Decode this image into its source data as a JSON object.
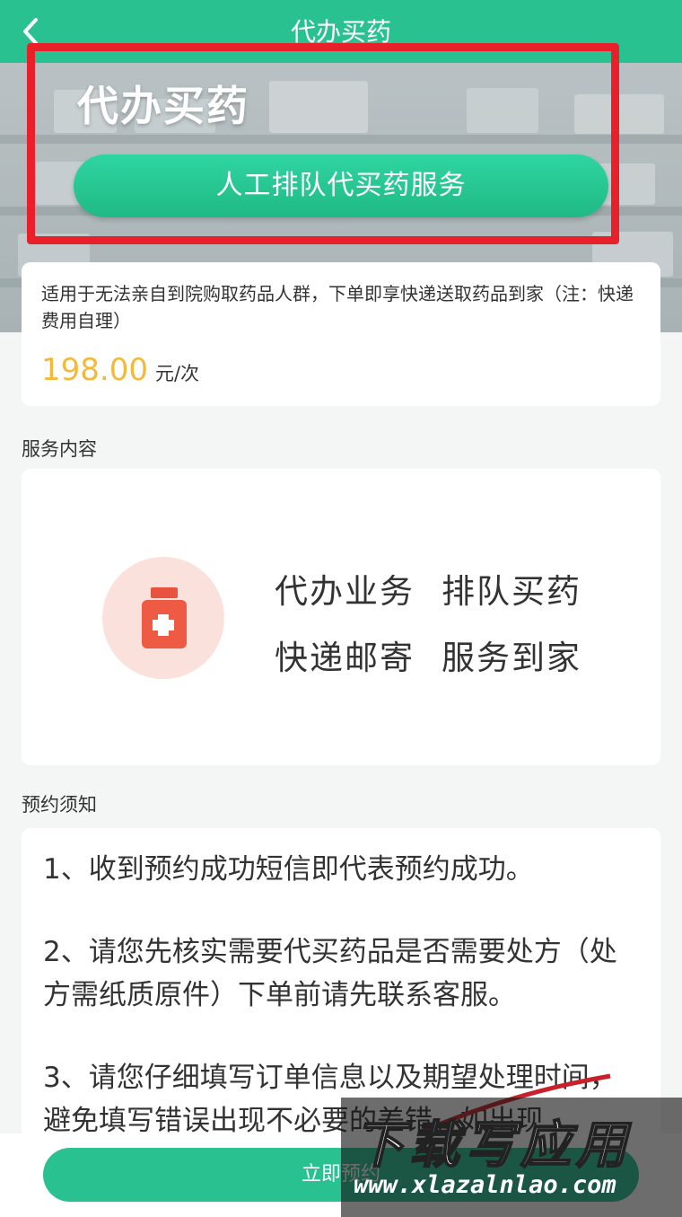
{
  "header": {
    "title": "代办买药"
  },
  "banner": {
    "title": "代办买药",
    "button_label": "人工排队代买药服务"
  },
  "price_card": {
    "description": "适用于无法亲自到院购取药品人群，下单即享快递送取药品到家（注：快递费用自理）",
    "price": "198.00",
    "unit": "元/次"
  },
  "service": {
    "section_title": "服务内容",
    "items": [
      "代办业务",
      "排队买药",
      "快递邮寄",
      "服务到家"
    ]
  },
  "notice": {
    "section_title": "预约须知",
    "items": [
      "1、收到预约成功短信即代表预约成功。",
      "2、请您先核实需要代买药品是否需要处方（处方需纸质原件）下单前请先联系客服。",
      "3、请您仔细填写订单信息以及期望处理时间，避免填写错误出现不必要的差错，如出现"
    ]
  },
  "footer": {
    "button_label": "立即预约"
  },
  "watermark": {
    "text": "下载写应用",
    "url": "www.xlazalnlao.com"
  },
  "colors": {
    "brand_green": "#29c190",
    "price_orange": "#f5b93a",
    "highlight_red": "#e8202a"
  }
}
